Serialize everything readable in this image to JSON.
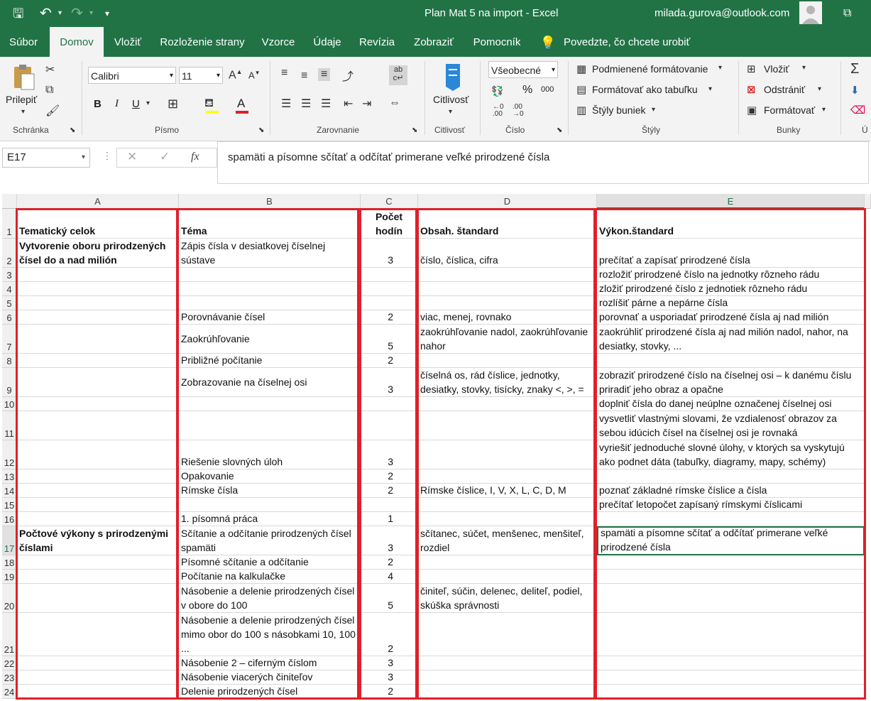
{
  "app": {
    "title": "Plan Mat 5 na import",
    "app_name": "Excel",
    "title_sep": "-",
    "user_email": "milada.gurova@outlook.com"
  },
  "tabs": [
    "Súbor",
    "Domov",
    "Vložiť",
    "Rozloženie strany",
    "Vzorce",
    "Údaje",
    "Revízia",
    "Zobraziť",
    "Pomocník"
  ],
  "tell_me": "Povedzte, čo chcete urobiť",
  "ribbon": {
    "clipboard": {
      "label": "Schránka",
      "paste": "Prilepiť"
    },
    "font": {
      "label": "Písmo",
      "name": "Calibri",
      "size": "11",
      "bold": "B",
      "italic": "I",
      "underline": "U"
    },
    "alignment": {
      "label": "Zarovnanie"
    },
    "sensitivity": {
      "label": "Citlivosť",
      "button": "Citlivosť"
    },
    "number": {
      "label": "Číslo",
      "format": "Všeobecné",
      "percent": "%",
      "thousands": "000"
    },
    "styles": {
      "label": "Štýly",
      "conditional": "Podmienené formátovanie",
      "format_table": "Formátovať ako tabuľku",
      "cell_styles": "Štýly buniek"
    },
    "cells": {
      "label": "Bunky",
      "insert": "Vložiť",
      "delete": "Odstrániť",
      "format": "Formátovať"
    },
    "editing": {
      "label": "Ú"
    }
  },
  "formula_bar": {
    "name_box": "E17",
    "fx": "fx",
    "content": "spamäti a písomne sčítať a odčítať primerane veľké prirodzené čísla"
  },
  "columns": [
    "A",
    "B",
    "C",
    "D",
    "E"
  ],
  "selected_cell": "E17",
  "rows": [
    {
      "n": "1",
      "h": 42,
      "a": "Tematický celok",
      "b": "Téma",
      "c": "Počet hodín",
      "d": "Obsah. štandard",
      "e": "Výkon.štandard",
      "header": true
    },
    {
      "n": "2",
      "h": 41,
      "a": "Vytvorenie oboru prirodzených čísel do a nad milión",
      "b": "Zápis čísla v desiatkovej číselnej sústave",
      "c": "3",
      "d": "číslo, číslica, cifra",
      "e": "prečítať a zapísať prirodzené čísla"
    },
    {
      "n": "3",
      "h": 20,
      "a": "",
      "b": "",
      "c": "",
      "d": "",
      "e": "rozložiť prirodzené číslo na jednotky rôzneho rádu"
    },
    {
      "n": "4",
      "h": 20,
      "a": "",
      "b": "",
      "c": "",
      "d": "",
      "e": "zložiť prirodzené číslo z jednotiek rôzneho rádu"
    },
    {
      "n": "5",
      "h": 20,
      "a": "",
      "b": "",
      "c": "",
      "d": "",
      "e": "rozlíšiť párne a nepárne čísla"
    },
    {
      "n": "6",
      "h": 20,
      "a": "",
      "b": "Porovnávanie čísel",
      "c": "2",
      "d": "viac, menej, rovnako",
      "e": "porovnať a usporiadať prirodzené čísla aj nad milión"
    },
    {
      "n": "7",
      "h": 41,
      "a": "",
      "b": "Zaokrúhľovanie",
      "c": "5",
      "d": "zaokrúhľovanie nadol, zaokrúhľovanie nahor",
      "e": "zaokrúhliť prirodzené čísla aj nad milión nadol, nahor, na desiatky, stovky, ..."
    },
    {
      "n": "8",
      "h": 20,
      "a": "",
      "b": "Približné počítanie",
      "c": "2",
      "d": "",
      "e": ""
    },
    {
      "n": "9",
      "h": 41,
      "a": "",
      "b": "Zobrazovanie na číselnej osi",
      "c": "3",
      "d": "číselná os, rád číslice, jednotky, desiatky, stovky, tisícky, znaky <, >, =",
      "e": "zobraziť prirodzené číslo na číselnej osi – k danému číslu priradiť jeho obraz a opačne"
    },
    {
      "n": "10",
      "h": 20,
      "a": "",
      "b": "",
      "c": "",
      "d": "",
      "e": "doplniť čísla do danej neúplne označenej číselnej osi"
    },
    {
      "n": "11",
      "h": 41,
      "a": "",
      "b": "",
      "c": "",
      "d": "",
      "e": "vysvetliť vlastnými slovami, že vzdialenosť obrazov za sebou idúcich čísel na číselnej osi je rovnaká"
    },
    {
      "n": "12",
      "h": 41,
      "a": "",
      "b": "Riešenie slovných úloh",
      "c": "3",
      "d": "",
      "e": "vyriešiť jednoduché slovné úlohy, v ktorých sa vyskytujú ako podnet dáta (tabuľky, diagramy, mapy, schémy)"
    },
    {
      "n": "13",
      "h": 20,
      "a": "",
      "b": "Opakovanie",
      "c": "2",
      "d": "",
      "e": ""
    },
    {
      "n": "14",
      "h": 20,
      "a": "",
      "b": "Rímske čísla",
      "c": "2",
      "d": "Rímske číslice, I, V, X, L, C, D, M",
      "e": "poznať základné rímske číslice a čísla"
    },
    {
      "n": "15",
      "h": 20,
      "a": "",
      "b": "",
      "c": "",
      "d": "",
      "e": "prečítať letopočet zapísaný rímskymi číslicami"
    },
    {
      "n": "16",
      "h": 20,
      "a": "",
      "b": "1. písomná   práca",
      "c": "1",
      "d": "",
      "e": ""
    },
    {
      "n": "17",
      "h": 41,
      "a": "Počtové výkony s prirodzenými číslami",
      "b": "Sčítanie a odčítanie prirodzených čísel spamäti",
      "c": "3",
      "d": "sčítanec, súčet, menšenec, menšiteľ, rozdiel",
      "e": "spamäti a písomne sčítať a odčítať primerane veľké prirodzené čísla"
    },
    {
      "n": "18",
      "h": 20,
      "a": "",
      "b": "Písomné   sčítanie a odčítanie",
      "c": "2",
      "d": "",
      "e": ""
    },
    {
      "n": "19",
      "h": 20,
      "a": "",
      "b": "Počítanie na kalkulačke",
      "c": "4",
      "d": "",
      "e": ""
    },
    {
      "n": "20",
      "h": 41,
      "a": "",
      "b": "Násobenie a delenie prirodzených čísel v obore do 100",
      "c": "5",
      "d": "činiteľ, súčin, delenec, deliteľ, podiel, skúška správnosti",
      "e": ""
    },
    {
      "n": "21",
      "h": 61,
      "a": "",
      "b": "Násobenie a delenie prirodzených čísel mimo obor do 100 s násobkami 10, 100 ...",
      "c": "2",
      "d": "",
      "e": ""
    },
    {
      "n": "22",
      "h": 20,
      "a": "",
      "b": "Násobenie 2 – ciferným číslom",
      "c": "3",
      "d": "",
      "e": ""
    },
    {
      "n": "23",
      "h": 20,
      "a": "",
      "b": "Násobenie viacerých činiteľov",
      "c": "3",
      "d": "",
      "e": ""
    },
    {
      "n": "24",
      "h": 20,
      "a": "",
      "b": "Delenie prirodzených čísel",
      "c": "2",
      "d": "",
      "e": ""
    }
  ]
}
